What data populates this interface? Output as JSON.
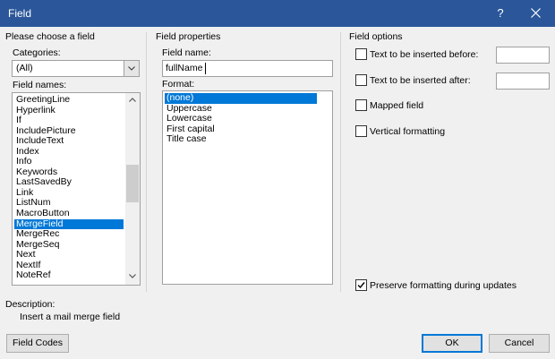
{
  "window": {
    "title": "Field",
    "help_label": "?"
  },
  "left": {
    "header": "Please choose a field",
    "categories_label": "Categories:",
    "categories_value": "(All)",
    "field_names_label": "Field names:",
    "field_names": [
      "GreetingLine",
      "Hyperlink",
      "If",
      "IncludePicture",
      "IncludeText",
      "Index",
      "Info",
      "Keywords",
      "LastSavedBy",
      "Link",
      "ListNum",
      "MacroButton",
      "MergeField",
      "MergeRec",
      "MergeSeq",
      "Next",
      "NextIf",
      "NoteRef"
    ],
    "selected_field": "MergeField"
  },
  "middle": {
    "header": "Field properties",
    "field_name_label": "Field name:",
    "field_name_value": "fullName",
    "format_label": "Format:",
    "formats": [
      "(none)",
      "Uppercase",
      "Lowercase",
      "First capital",
      "Title case"
    ],
    "selected_format": "(none)"
  },
  "right": {
    "header": "Field options",
    "opt_before_label": "Text to be inserted before:",
    "opt_before_checked": false,
    "opt_after_label": "Text to be inserted after:",
    "opt_after_checked": false,
    "mapped_label": "Mapped field",
    "mapped_checked": false,
    "vertical_label": "Vertical formatting",
    "vertical_checked": false,
    "preserve_label": "Preserve formatting during updates",
    "preserve_checked": true
  },
  "description": {
    "label": "Description:",
    "text": "Insert a mail merge field"
  },
  "buttons": {
    "field_codes": "Field Codes",
    "ok": "OK",
    "cancel": "Cancel"
  },
  "colors": {
    "titlebar": "#2b579a",
    "selection": "#0078d7"
  }
}
